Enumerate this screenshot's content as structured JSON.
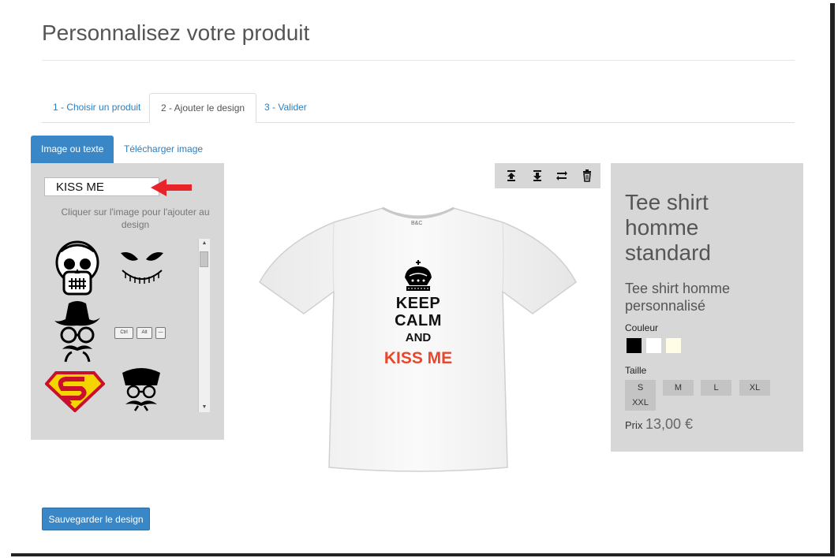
{
  "page_title": "Personnalisez votre produit",
  "steps": [
    {
      "label": "1 - Choisir un produit"
    },
    {
      "label": "2 - Ajouter le design"
    },
    {
      "label": "3 - Valider"
    }
  ],
  "subtabs": [
    {
      "label": "Image ou texte"
    },
    {
      "label": "Télécharger image"
    }
  ],
  "left_panel": {
    "text_value": "KISS ME",
    "hint": "Cliquer sur l'image pour l'ajouter au design",
    "gallery_icons": [
      "skull-icon",
      "jack-face-icon",
      "cowboy-mustache-icon",
      "keyboard-keys-icon",
      "superman-logo-icon",
      "chef-mustache-icon"
    ],
    "keyboard_keys": [
      "Ctrl",
      "Alt",
      "—"
    ]
  },
  "toolbar": {
    "icons": [
      "bring-to-front-icon",
      "send-to-back-icon",
      "flip-icon",
      "trash-icon"
    ]
  },
  "design": {
    "line1": "KEEP",
    "line2": "CALM",
    "line3": "AND",
    "line4": "KISS ME",
    "shirt_tag": "B&C"
  },
  "product": {
    "title": "Tee shirt homme standard",
    "subtitle": "Tee shirt homme personnalisé",
    "color_label": "Couleur",
    "colors": [
      "#000000",
      "#ffffff",
      "#fffde5"
    ],
    "size_label": "Taille",
    "sizes": [
      "S",
      "M",
      "L",
      "XL",
      "XXL"
    ],
    "price_label": "Prix",
    "price": "13,00 €"
  },
  "save_button": "Sauvegarder le design"
}
